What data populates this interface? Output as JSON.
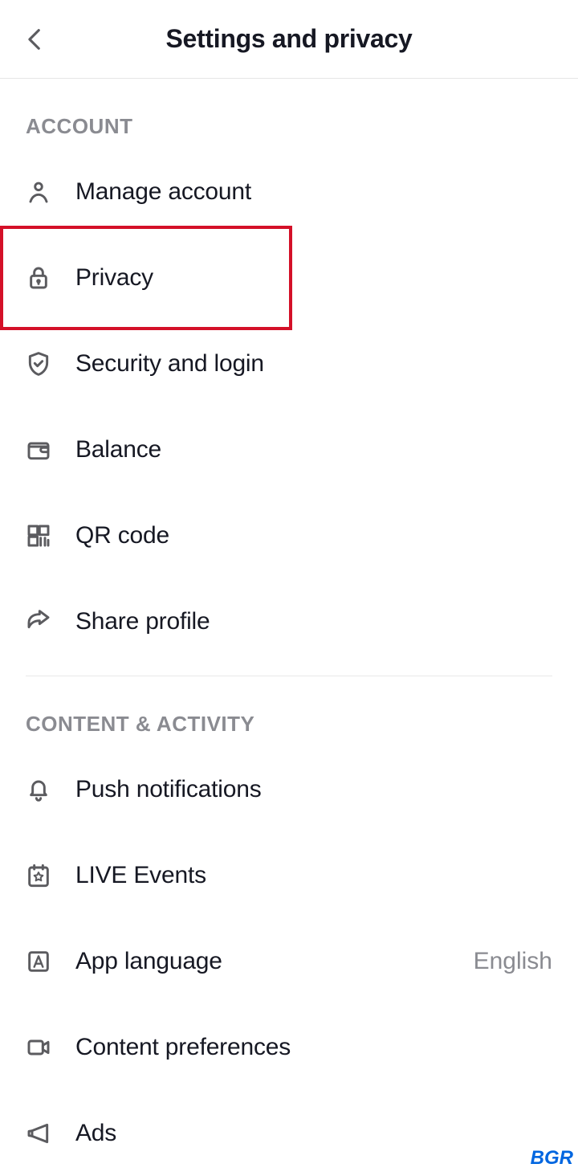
{
  "header": {
    "title": "Settings and privacy"
  },
  "sections": {
    "account": {
      "title": "ACCOUNT",
      "items": [
        {
          "label": "Manage account"
        },
        {
          "label": "Privacy"
        },
        {
          "label": "Security and login"
        },
        {
          "label": "Balance"
        },
        {
          "label": "QR code"
        },
        {
          "label": "Share profile"
        }
      ]
    },
    "content": {
      "title": "CONTENT & ACTIVITY",
      "items": [
        {
          "label": "Push notifications"
        },
        {
          "label": "LIVE Events"
        },
        {
          "label": "App language",
          "value": "English"
        },
        {
          "label": "Content preferences"
        },
        {
          "label": "Ads"
        }
      ]
    }
  },
  "watermark": "BGR"
}
